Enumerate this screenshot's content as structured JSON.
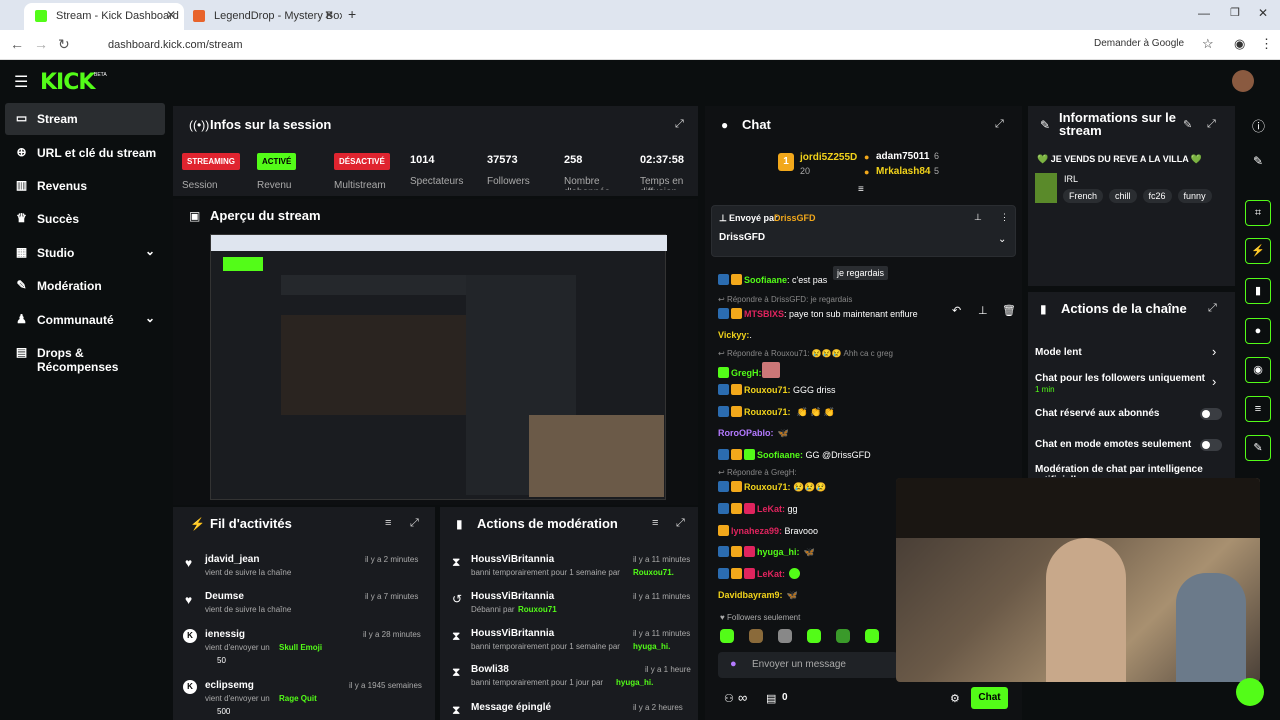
{
  "browser": {
    "tab1": "Stream - Kick Dashboard",
    "tab2": "LegendDrop - Mystery Boxes &",
    "url": "dashboard.kick.com/stream",
    "ask_google": "Demander à Google"
  },
  "app": {
    "logo": "KICK",
    "beta": "BETA"
  },
  "sidebar": {
    "items": [
      {
        "label": "Stream",
        "icon": "video-icon"
      },
      {
        "label": "URL et clé du stream",
        "icon": "link-icon"
      },
      {
        "label": "Revenus",
        "icon": "chart-icon"
      },
      {
        "label": "Succès",
        "icon": "trophy-icon"
      },
      {
        "label": "Studio",
        "icon": "studio-icon"
      },
      {
        "label": "Modération",
        "icon": "wrench-icon"
      },
      {
        "label": "Communauté",
        "icon": "community-icon"
      },
      {
        "label": "Drops & Récompenses",
        "icon": "drops-icon"
      }
    ]
  },
  "session": {
    "title": "Infos sur la session",
    "streaming": "STREAMING",
    "session_label": "Session",
    "active": "ACTIVÉ",
    "revenue_label": "Revenu",
    "disabled": "DÉSACTIVÉ",
    "multistream_label": "Multistream",
    "viewers": "1014",
    "viewers_label": "Spectateurs",
    "followers": "37573",
    "followers_label": "Followers",
    "subs": "258",
    "subs_label": "Nombre d'abonnés",
    "uptime": "02:37:58",
    "uptime_label": "Temps en diffusion"
  },
  "preview": {
    "title": "Aperçu du stream"
  },
  "activity": {
    "title": "Fil d'activités",
    "items": [
      {
        "name": "jdavid_jean",
        "time": "il y a 2 minutes",
        "text": "vient de suivre la chaîne",
        "extra": ""
      },
      {
        "name": "Deumse",
        "time": "il y a 7 minutes",
        "text": "vient de suivre la chaîne",
        "extra": ""
      },
      {
        "name": "ienessig",
        "time": "il y a 28 minutes",
        "text": "vient d'envoyer un",
        "extra": "Skull Emoji",
        "amount": "50"
      },
      {
        "name": "eclipsemg",
        "time": "il y a 1945 semaines",
        "text": "vient d'envoyer un",
        "extra": "Rage Quit",
        "amount": "500"
      }
    ]
  },
  "moderation": {
    "title": "Actions de modération",
    "items": [
      {
        "name": "HoussViBritannia",
        "time": "il y a 11 minutes",
        "text": "banni temporairement pour 1 semaine par",
        "who": "Rouxou71."
      },
      {
        "name": "HoussViBritannia",
        "time": "il y a 11 minutes",
        "text": "Débanni par",
        "who": "Rouxou71"
      },
      {
        "name": "HoussViBritannia",
        "time": "il y a 11 minutes",
        "text": "banni temporairement pour 1 semaine par",
        "who": "hyuga_hi."
      },
      {
        "name": "Bowli38",
        "time": "il y a 1 heure",
        "text": "banni temporairement pour 1 jour par",
        "who": "hyuga_hi."
      },
      {
        "name": "Message épinglé",
        "time": "il y a 2 heures",
        "text": "",
        "who": ""
      }
    ]
  },
  "chat": {
    "title": "Chat",
    "top1": "jordi5Z255D",
    "top1_count": "20",
    "top2": "adam75011",
    "top2_count": "6",
    "top3": "Mrkalash84",
    "top3_count": "5",
    "pinned_by_label": "Envoyé par",
    "pinned_by": "DrissGFD",
    "pinned_text": "DrissGFD",
    "tooltip": "je regardais",
    "lines": [
      {
        "user": "Soofiaane",
        "msg": ": c'est pas",
        "color": "#53fc18",
        "reply": ""
      },
      {
        "user": "",
        "msg": "",
        "color": "",
        "reply": "Répondre à DrissGFD: je regardais"
      },
      {
        "user": "MTSBIXS",
        "msg": ": paye ton sub maintenant enflure",
        "color": "#e0245e",
        "reply": ""
      },
      {
        "user": "Vickyy:",
        "msg": ".",
        "color": "#f2d31b",
        "reply": ""
      },
      {
        "user": "",
        "msg": "",
        "color": "",
        "reply": "Répondre à Rouxou71: 😢😢😢 Ahh ca c greg"
      },
      {
        "user": "GregH:",
        "msg": "",
        "color": "#53fc18",
        "reply": ""
      },
      {
        "user": "Rouxou71:",
        "msg": " GGG driss",
        "color": "#f2d31b",
        "reply": ""
      },
      {
        "user": "Rouxou71:",
        "msg": "",
        "color": "#f2d31b",
        "reply": ""
      },
      {
        "user": "RoroOPablo:",
        "msg": "",
        "color": "#b47aff",
        "reply": ""
      },
      {
        "user": "Soofiaane:",
        "msg": " GG @DrissGFD",
        "color": "#53fc18",
        "reply": ""
      },
      {
        "user": "",
        "msg": "",
        "color": "",
        "reply": "Répondre à GregH:"
      },
      {
        "user": "Rouxou71:",
        "msg": " 😢😢😢",
        "color": "#f2d31b",
        "reply": ""
      },
      {
        "user": "LeKat:",
        "msg": " gg",
        "color": "#e0245e",
        "reply": ""
      },
      {
        "user": "lynaheza99:",
        "msg": " Bravooo",
        "color": "#e0245e",
        "reply": ""
      },
      {
        "user": "hyuga_hi:",
        "msg": "",
        "color": "#53fc18",
        "reply": ""
      },
      {
        "user": "LeKat:",
        "msg": "",
        "color": "#e0245e",
        "reply": ""
      },
      {
        "user": "Davidbayram9:",
        "msg": "",
        "color": "#f2d31b",
        "reply": ""
      }
    ],
    "followers_only": "Followers seulement",
    "placeholder": "Envoyer un message",
    "infinity": "∞",
    "count": "0",
    "send": "Chat"
  },
  "info": {
    "title": "Informations sur le stream",
    "stream_title": "💚 JE VENDS DU REVE A LA VILLA 💚",
    "category": "IRL",
    "tags": [
      "French",
      "chill",
      "fc26",
      "funny"
    ]
  },
  "channel": {
    "title": "Actions de la chaîne",
    "rows": [
      {
        "label": "Mode lent",
        "sub": ""
      },
      {
        "label": "Chat pour les followers uniquement",
        "sub": "1 min"
      },
      {
        "label": "Chat réservé aux abonnés",
        "sub": ""
      },
      {
        "label": "Chat en mode emotes seulement",
        "sub": ""
      },
      {
        "label": "Modération de chat par intelligence artificielle",
        "sub": ""
      }
    ]
  },
  "colors": {
    "accent": "#53fc18",
    "bg": "#0b0e0f",
    "panel": "#191b1f",
    "red": "#e0242f"
  }
}
